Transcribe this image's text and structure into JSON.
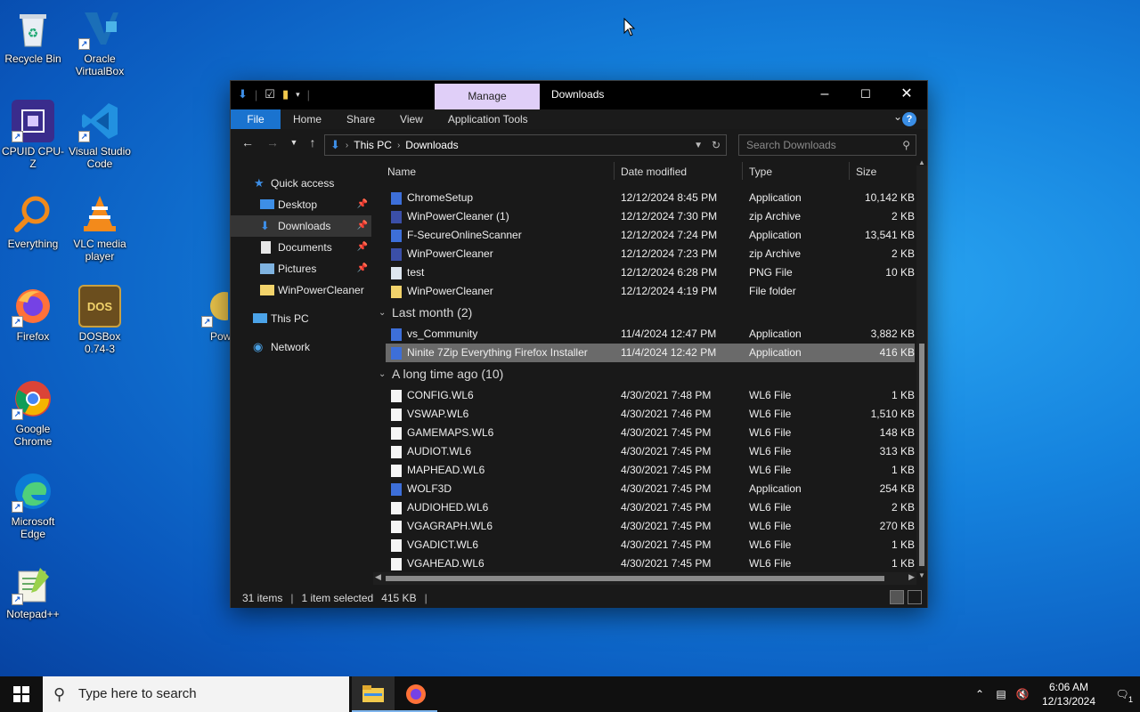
{
  "desktop": {
    "icons": [
      {
        "label": "Recycle Bin"
      },
      {
        "label": "Oracle VirtualBox"
      },
      {
        "label": "CPUID CPU-Z"
      },
      {
        "label": "Visual Studio Code"
      },
      {
        "label": "Everything"
      },
      {
        "label": "VLC media player"
      },
      {
        "label": "Firefox"
      },
      {
        "label": "DOSBox 0.74-3"
      },
      {
        "label": "Pow"
      },
      {
        "label": "Google Chrome"
      },
      {
        "label": "Microsoft Edge"
      },
      {
        "label": "Notepad++"
      }
    ]
  },
  "window": {
    "title": "Downloads",
    "manage_tab": "Manage",
    "ribbon": {
      "file": "File",
      "home": "Home",
      "share": "Share",
      "view": "View",
      "app_tools": "Application Tools"
    },
    "help": "?",
    "address": {
      "crumb1": "This PC",
      "crumb2": "Downloads"
    },
    "search_placeholder": "Search Downloads",
    "nav": {
      "quick_access": "Quick access",
      "desktop": "Desktop",
      "downloads": "Downloads",
      "documents": "Documents",
      "pictures": "Pictures",
      "winpowercleaner": "WinPowerCleaner",
      "this_pc": "This PC",
      "network": "Network"
    },
    "columns": {
      "name": "Name",
      "date": "Date modified",
      "type": "Type",
      "size": "Size"
    },
    "files_recent": [
      {
        "name": "ChromeSetup",
        "date": "12/12/2024 8:45 PM",
        "type": "Application",
        "size": "10,142 KB"
      },
      {
        "name": "WinPowerCleaner (1)",
        "date": "12/12/2024 7:30 PM",
        "type": "zip Archive",
        "size": "2 KB"
      },
      {
        "name": "F-SecureOnlineScanner",
        "date": "12/12/2024 7:24 PM",
        "type": "Application",
        "size": "13,541 KB"
      },
      {
        "name": "WinPowerCleaner",
        "date": "12/12/2024 7:23 PM",
        "type": "zip Archive",
        "size": "2 KB"
      },
      {
        "name": "test",
        "date": "12/12/2024 6:28 PM",
        "type": "PNG File",
        "size": "10 KB"
      },
      {
        "name": "WinPowerCleaner",
        "date": "12/12/2024 4:19 PM",
        "type": "File folder",
        "size": ""
      }
    ],
    "group_last_month": "Last month (2)",
    "files_last_month": [
      {
        "name": "vs_Community",
        "date": "11/4/2024 12:47 PM",
        "type": "Application",
        "size": "3,882 KB"
      },
      {
        "name": "Ninite 7Zip Everything Firefox Installer",
        "date": "11/4/2024 12:42 PM",
        "type": "Application",
        "size": "416 KB"
      }
    ],
    "group_long_ago": "A long time ago (10)",
    "files_long_ago": [
      {
        "name": "CONFIG.WL6",
        "date": "4/30/2021 7:48 PM",
        "type": "WL6 File",
        "size": "1 KB"
      },
      {
        "name": "VSWAP.WL6",
        "date": "4/30/2021 7:46 PM",
        "type": "WL6 File",
        "size": "1,510 KB"
      },
      {
        "name": "GAMEMAPS.WL6",
        "date": "4/30/2021 7:45 PM",
        "type": "WL6 File",
        "size": "148 KB"
      },
      {
        "name": "AUDIOT.WL6",
        "date": "4/30/2021 7:45 PM",
        "type": "WL6 File",
        "size": "313 KB"
      },
      {
        "name": "MAPHEAD.WL6",
        "date": "4/30/2021 7:45 PM",
        "type": "WL6 File",
        "size": "1 KB"
      },
      {
        "name": "WOLF3D",
        "date": "4/30/2021 7:45 PM",
        "type": "Application",
        "size": "254 KB"
      },
      {
        "name": "AUDIOHED.WL6",
        "date": "4/30/2021 7:45 PM",
        "type": "WL6 File",
        "size": "2 KB"
      },
      {
        "name": "VGAGRAPH.WL6",
        "date": "4/30/2021 7:45 PM",
        "type": "WL6 File",
        "size": "270 KB"
      },
      {
        "name": "VGADICT.WL6",
        "date": "4/30/2021 7:45 PM",
        "type": "WL6 File",
        "size": "1 KB"
      },
      {
        "name": "VGAHEAD.WL6",
        "date": "4/30/2021 7:45 PM",
        "type": "WL6 File",
        "size": "1 KB"
      }
    ],
    "status": {
      "items": "31 items",
      "selected": "1 item selected",
      "size": "415 KB"
    }
  },
  "taskbar": {
    "search_placeholder": "Type here to search",
    "time": "6:06 AM",
    "date": "12/13/2024",
    "notification_count": "1"
  },
  "colors": {
    "accent": "#1a73cf",
    "manage_tab": "#e0cff8",
    "selection": "#6a6a6a"
  }
}
